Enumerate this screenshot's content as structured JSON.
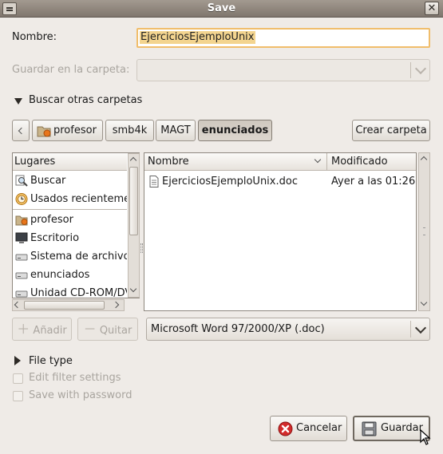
{
  "window": {
    "title": "Save"
  },
  "form": {
    "name_label": "Nombre:",
    "name_value": "EjerciciosEjemploUnix",
    "folder_label": "Guardar en la carpeta:",
    "browse_label": "Buscar otras carpetas"
  },
  "pathbar": {
    "segments": [
      "profesor",
      "smb4k",
      "MAGT",
      "enunciados"
    ],
    "create_folder": "Crear carpeta"
  },
  "places": {
    "header": "Lugares",
    "items": [
      {
        "label": "Buscar",
        "icon": "search-icon"
      },
      {
        "label": "Usados recientemente",
        "icon": "recent-icon"
      },
      {
        "label": "profesor",
        "icon": "home-folder-icon"
      },
      {
        "label": "Escritorio",
        "icon": "desktop-icon"
      },
      {
        "label": "Sistema de archivos",
        "icon": "drive-icon"
      },
      {
        "label": "enunciados",
        "icon": "drive-icon"
      },
      {
        "label": "Unidad CD-ROM/DVD",
        "icon": "cdrom-icon"
      }
    ],
    "add_label": "Añadir",
    "remove_label": "Quitar"
  },
  "files": {
    "col_name": "Nombre",
    "col_modified": "Modificado",
    "rows": [
      {
        "name": "EjerciciosEjemploUnix.doc",
        "modified": "Ayer a las 01:26",
        "icon": "document-icon"
      }
    ],
    "filter": "Microsoft Word 97/2000/XP (.doc)"
  },
  "options": {
    "file_type_label": "File type",
    "edit_filter": "Edit filter settings",
    "save_password": "Save with password"
  },
  "buttons": {
    "cancel": "Cancelar",
    "save": "Guardar"
  },
  "colors": {
    "title_bar": "#8e857b",
    "selection": "#f3d48f",
    "focus": "#f0bd6b",
    "cancel_icon": "#d22b2b"
  }
}
